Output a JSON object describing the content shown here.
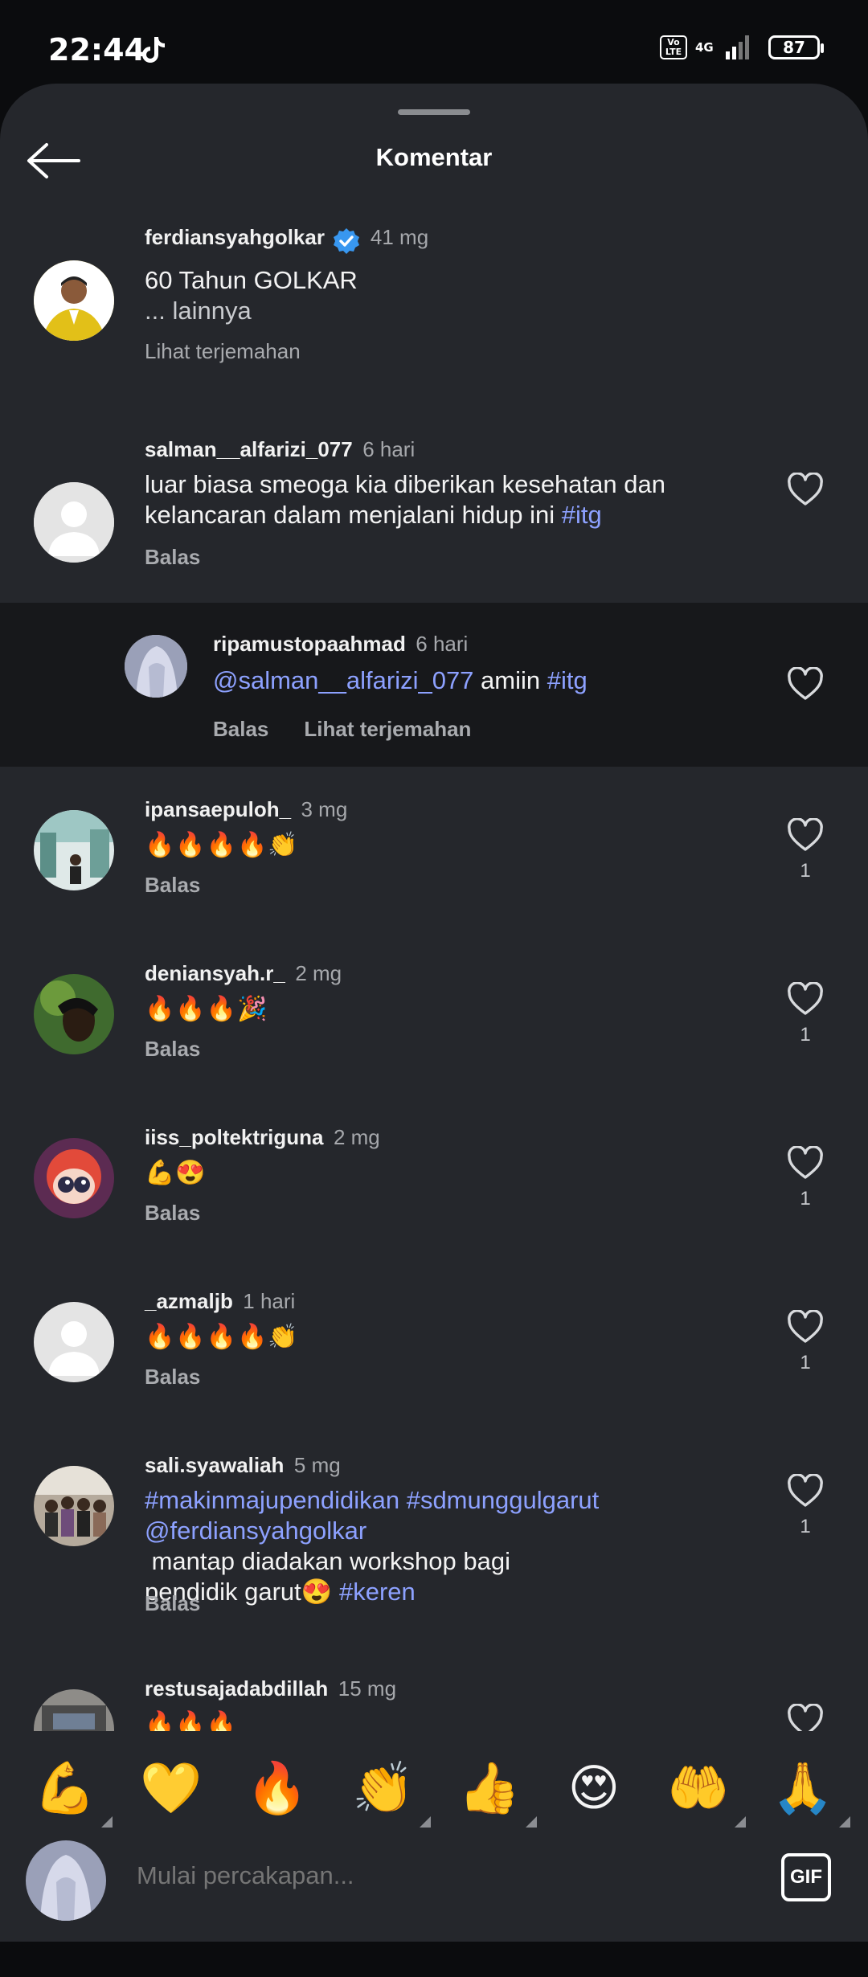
{
  "status_bar": {
    "time": "22:44",
    "network": "4G",
    "volte": "Vo LTE",
    "battery": "87"
  },
  "sheet": {
    "title": "Komentar"
  },
  "comments": [
    {
      "username": "ferdiansyahgolkar",
      "verified": true,
      "time": "41 mg",
      "text_line1": "60 Tahun GOLKAR",
      "text_line2": "... lainnya",
      "action": "Lihat terjemahan"
    },
    {
      "username": "salman__alfarizi_077",
      "time": "6 hari",
      "text_line1": "luar biasa smeoga kia diberikan kesehatan dan",
      "text_line2": "kelancaran dalam menjalani hidup ini",
      "hashtag": "#itg",
      "action": "Balas"
    },
    {
      "username": "ripamustopaahmad",
      "time": "6 hari",
      "mention": "@salman__alfarizi_077",
      "text": " amiin ",
      "hashtag": "#itg",
      "action_reply": "Balas",
      "action_translate": "Lihat terjemahan"
    },
    {
      "username": "ipansaepuloh_",
      "time": "3 mg",
      "emojis": "🔥🔥🔥🔥👏",
      "action": "Balas",
      "likes": "1"
    },
    {
      "username": "deniansyah.r_",
      "time": "2 mg",
      "emojis": "🔥🔥🔥🎉",
      "action": "Balas",
      "likes": "1"
    },
    {
      "username": "iiss_poltektriguna",
      "time": "2 mg",
      "emojis": "💪😍",
      "action": "Balas",
      "likes": "1"
    },
    {
      "username": "_azmaljb",
      "time": "1 hari",
      "emojis": "🔥🔥🔥🔥👏",
      "action": "Balas",
      "likes": "1"
    },
    {
      "username": "sali.syawaliah",
      "time": "5 mg",
      "hashtags_line1": "#makinmajupendidikan #sdmunggulgarut",
      "mention": "@ferdiansyahgolkar",
      "text_line2": " mantap diadakan workshop bagi",
      "text_line3": "pendidik garut😍 ",
      "hashtag": "#keren",
      "action": "Balas",
      "likes": "1"
    },
    {
      "username": "restusajadabdillah",
      "time": "15 mg",
      "emojis": "🔥🔥🔥"
    }
  ],
  "emoji_bar": [
    "💪",
    "💛",
    "🔥",
    "👏",
    "👍",
    "😍",
    "🤲",
    "🙏"
  ],
  "input": {
    "placeholder": "Mulai percakapan...",
    "gif_label": "GIF"
  },
  "icons": {
    "back": "arrow-left-icon",
    "like": "heart-outline-icon",
    "verified": "verified-badge-icon",
    "tiktok": "tiktok-icon"
  },
  "colors": {
    "sheet_bg": "#25272c",
    "reply_bg": "#17181b",
    "link": "#8da1ff",
    "verified": "#3897f0"
  }
}
